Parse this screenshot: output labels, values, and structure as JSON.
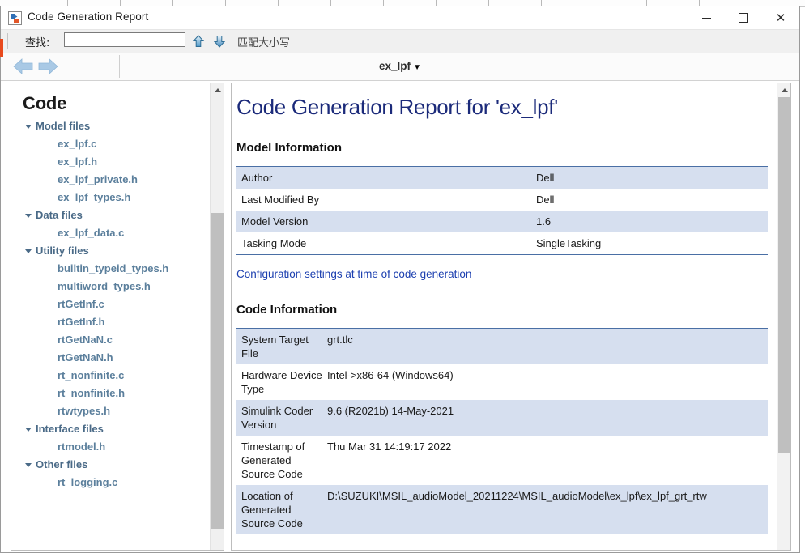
{
  "window": {
    "title": "Code Generation Report",
    "app_icon": "simulink-icon",
    "controls": {
      "minimize": "minimize-icon",
      "maximize": "maximize-icon",
      "close": "close-icon"
    }
  },
  "findbar": {
    "label": "查找:",
    "input_value": "",
    "input_placeholder": "",
    "find_previous_icon": "arrow-up-icon",
    "find_next_icon": "arrow-down-icon",
    "match_case_label": "匹配大小写"
  },
  "navbar": {
    "back_icon": "arrow-left-icon",
    "forward_icon": "arrow-right-icon",
    "model_name": "ex_lpf",
    "caret": "▼"
  },
  "sidebar": {
    "title": "Code",
    "groups": [
      {
        "label": "Model files",
        "items": [
          "ex_lpf.c",
          "ex_lpf.h",
          "ex_lpf_private.h",
          "ex_lpf_types.h"
        ]
      },
      {
        "label": "Data files",
        "items": [
          "ex_lpf_data.c"
        ]
      },
      {
        "label": "Utility files",
        "items": [
          "builtin_typeid_types.h",
          "multiword_types.h",
          "rtGetInf.c",
          "rtGetInf.h",
          "rtGetNaN.c",
          "rtGetNaN.h",
          "rt_nonfinite.c",
          "rt_nonfinite.h",
          "rtwtypes.h"
        ]
      },
      {
        "label": "Interface files",
        "items": [
          "rtmodel.h"
        ]
      },
      {
        "label": "Other files",
        "items": [
          "rt_logging.c"
        ]
      }
    ]
  },
  "content": {
    "title": "Code Generation Report for 'ex_lpf'",
    "model_information": {
      "heading": "Model Information",
      "rows": [
        {
          "key": "Author",
          "value": "Dell"
        },
        {
          "key": "Last Modified By",
          "value": "Dell"
        },
        {
          "key": "Model Version",
          "value": "1.6"
        },
        {
          "key": "Tasking Mode",
          "value": "SingleTasking"
        }
      ]
    },
    "config_link": "Configuration settings at time of code generation",
    "code_information": {
      "heading": "Code Information",
      "rows": [
        {
          "key": "System Target File",
          "value": "grt.tlc"
        },
        {
          "key": "Hardware Device Type",
          "value": "Intel->x86-64 (Windows64)"
        },
        {
          "key": "Simulink Coder Version",
          "value": "9.6 (R2021b) 14-May-2021"
        },
        {
          "key": "Timestamp of Generated Source Code",
          "value": "Thu Mar 31 14:19:17 2022"
        },
        {
          "key": "Location of Generated Source Code",
          "value": "D:\\SUZUKI\\MSIL_audioModel_20211224\\MSIL_audioModel\\ex_lpf\\ex_lpf_grt_rtw"
        }
      ]
    }
  },
  "colors": {
    "title_blue": "#1b2a7a",
    "row_alt": "#d6dfef",
    "table_border": "#4a6fa5",
    "tree_link": "#5b7f9c",
    "link": "#1d40b0",
    "accent_red": "#e8491d"
  }
}
